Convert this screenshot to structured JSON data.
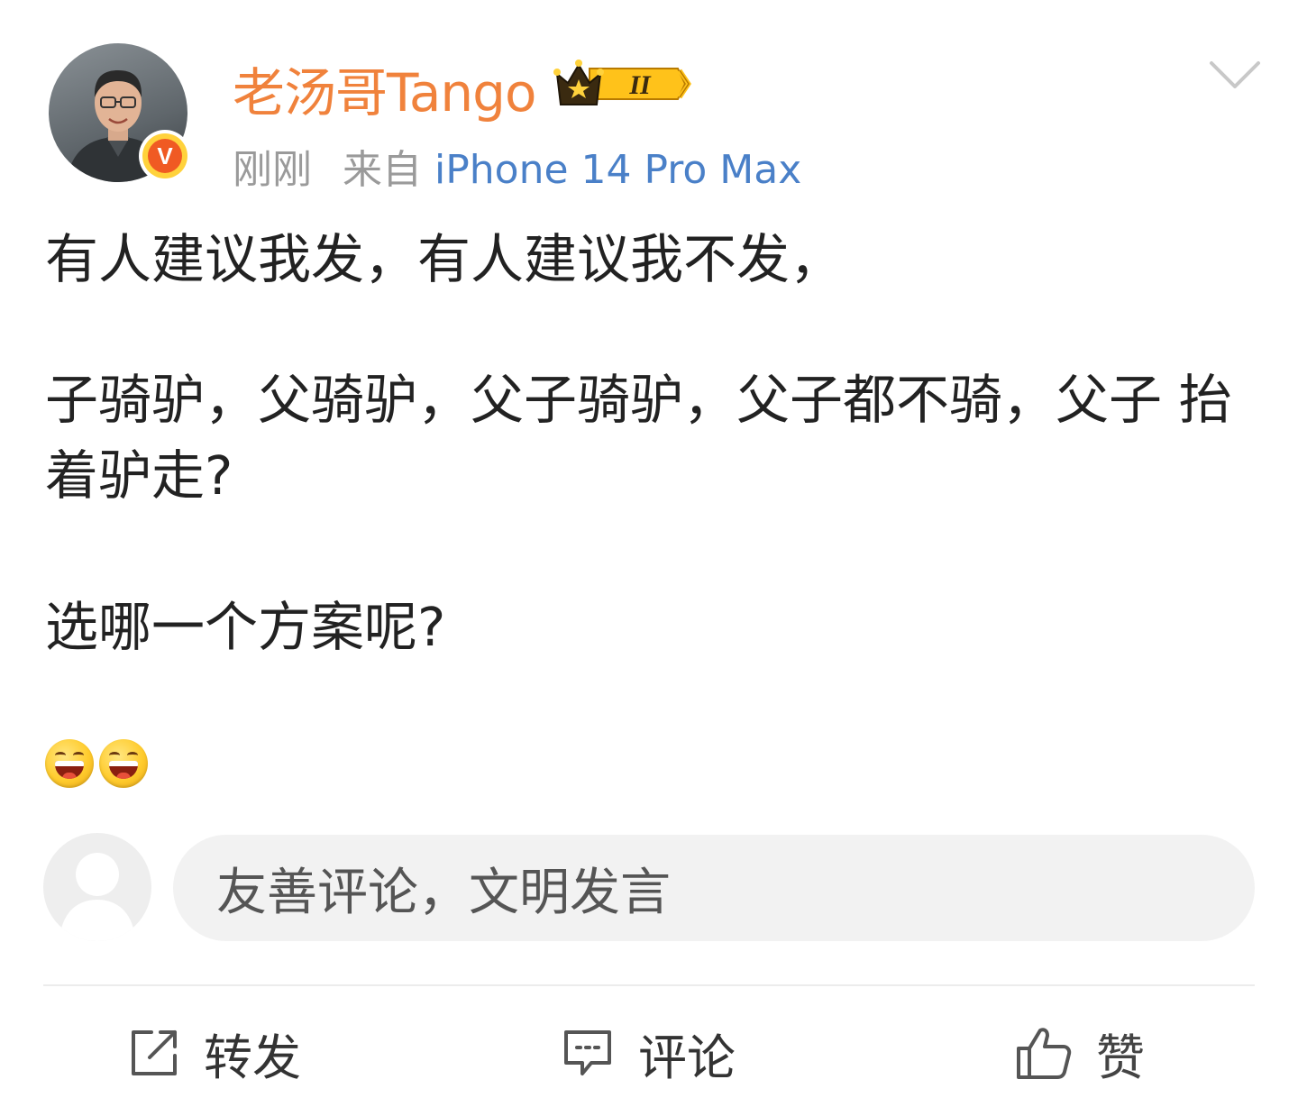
{
  "post": {
    "author": {
      "name": "老汤哥Tango",
      "verified_badge": "V",
      "vip_level": "II"
    },
    "meta": {
      "time": "刚刚",
      "source_prefix": "来自",
      "device": "iPhone 14 Pro Max"
    },
    "content": {
      "line1": "有人建议我发，有人建议我不发，",
      "line2": "子骑驴，父骑驴，父子骑驴，父子都不骑，父子 抬着驴走?",
      "line3": "选哪一个方案呢?",
      "emojis": [
        "laughing-tears-emoji",
        "laughing-tears-emoji"
      ]
    }
  },
  "comment": {
    "placeholder": "友善评论，文明发言"
  },
  "actions": {
    "repost_label": "转发",
    "comment_label": "评论",
    "like_label": "赞"
  },
  "colors": {
    "username": "#f0823c",
    "device_link": "#4a80c8",
    "meta_gray": "#9a9a9a",
    "verified_badge": "#f05a23",
    "vip_gold": "#ffc21a"
  }
}
